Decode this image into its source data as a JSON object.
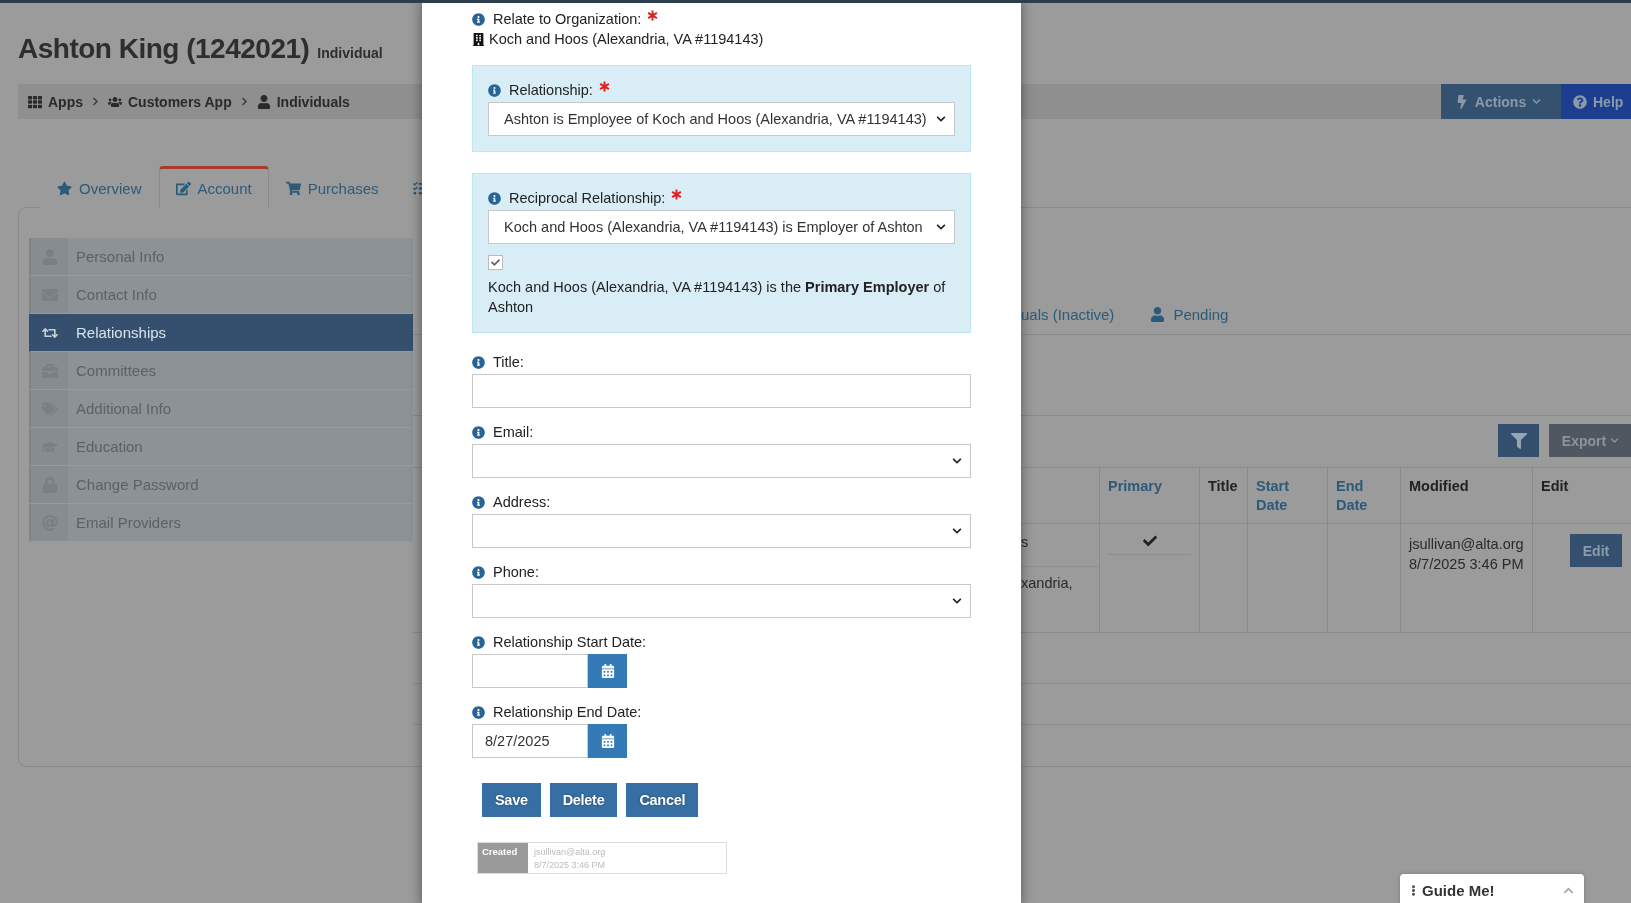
{
  "page": {
    "title": "Ashton King (1242021)",
    "type": "Individual"
  },
  "breadcrumb": [
    {
      "label": "Apps"
    },
    {
      "label": "Customers App"
    },
    {
      "label": "Individuals"
    }
  ],
  "header_actions": [
    {
      "label": "Actions"
    },
    {
      "label": "Help"
    }
  ],
  "tabs": [
    {
      "label": "Overview",
      "selected": false
    },
    {
      "label": "Account",
      "selected": true
    },
    {
      "label": "Purchases",
      "selected": false
    }
  ],
  "sidebar": {
    "items": [
      {
        "label": "Personal Info",
        "selected": false
      },
      {
        "label": "Contact Info",
        "selected": false
      },
      {
        "label": "Relationships",
        "selected": true
      },
      {
        "label": "Committees",
        "selected": false
      },
      {
        "label": "Additional Info",
        "selected": false
      },
      {
        "label": "Education",
        "selected": false
      },
      {
        "label": "Change Password",
        "selected": false
      },
      {
        "label": "Email Providers",
        "selected": false
      }
    ]
  },
  "subtabs": [
    {
      "label": "uals (Inactive)"
    },
    {
      "label": "Pending"
    }
  ],
  "toolbar": {
    "export": "Export"
  },
  "table": {
    "columns": [
      {
        "label": "Primary",
        "sortable": true
      },
      {
        "label": "Title",
        "sortable": false
      },
      {
        "label": "Start Date",
        "sortable": true
      },
      {
        "label": "End Date",
        "sortable": true
      },
      {
        "label": "Modified",
        "sortable": false
      },
      {
        "label": "Edit",
        "sortable": false
      }
    ],
    "rows": [
      {
        "column_1": [
          "s",
          "xandria,"
        ],
        "primary": true,
        "modified": [
          "jsullivan@alta.org",
          "8/7/2025 3:46 PM"
        ],
        "edit": "Edit"
      }
    ]
  },
  "modal": {
    "organization": {
      "label": "Relate to Organization:",
      "required": true,
      "value": "Koch and Hoos (Alexandria, VA #1194143)"
    },
    "relationship": {
      "label": "Relationship:",
      "required": true,
      "value": "Ashton is Employee of Koch and Hoos (Alexandria, VA #1194143)"
    },
    "reciprocal": {
      "label": "Reciprocal Relationship:",
      "required": true,
      "value": "Koch and Hoos (Alexandria, VA #1194143) is Employer of Ashton",
      "primary": {
        "checked": true,
        "text": "Koch and Hoos (Alexandria, VA #1194143) is the **Primary Employer** of Ashton"
      }
    },
    "fields": [
      {
        "kind": "text",
        "label": "Title:"
      },
      {
        "kind": "select",
        "label": "Email:"
      },
      {
        "kind": "select",
        "label": "Address:"
      },
      {
        "kind": "select",
        "label": "Phone:"
      },
      {
        "kind": "date",
        "label": "Relationship Start Date:"
      },
      {
        "kind": "date",
        "label": "Relationship End Date:",
        "value": "8/27/2025"
      }
    ],
    "buttons": [
      "Save",
      "Delete",
      "Cancel"
    ],
    "created": {
      "label": "Created",
      "by": "jsullivan@alta.org",
      "at": "8/7/2025 3:46 PM"
    }
  },
  "guide": {
    "label": "Guide Me!"
  }
}
